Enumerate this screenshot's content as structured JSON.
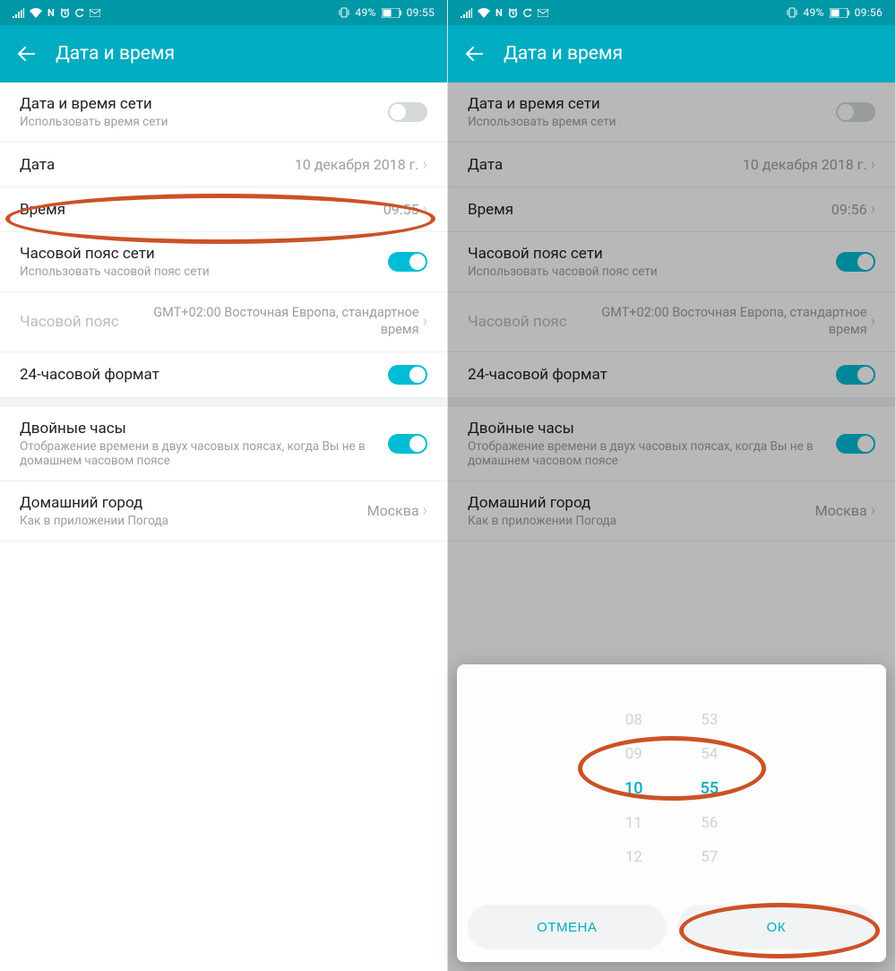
{
  "left": {
    "status": {
      "battery": "49%",
      "time": "09:55"
    },
    "header": {
      "title": "Дата и время"
    },
    "rows": {
      "network_time": {
        "title": "Дата и время сети",
        "sub": "Использовать время сети"
      },
      "date": {
        "title": "Дата",
        "value": "10 декабря 2018 г."
      },
      "time": {
        "title": "Время",
        "value": "09:55"
      },
      "tz_net": {
        "title": "Часовой пояс сети",
        "sub": "Использовать часовой пояс сети"
      },
      "tz": {
        "title": "Часовой пояс",
        "value": "GMT+02:00 Восточная Европа, стандартное время"
      },
      "h24": {
        "title": "24-часовой формат"
      },
      "dual": {
        "title": "Двойные часы",
        "sub": "Отображение времени в двух часовых поясах, когда Вы не в домашнем часовом поясе"
      },
      "home": {
        "title": "Домашний город",
        "sub": "Как в приложении Погода",
        "value": "Москва"
      }
    }
  },
  "right": {
    "status": {
      "battery": "49%",
      "time": "09:56"
    },
    "header": {
      "title": "Дата и время"
    },
    "rows": {
      "network_time": {
        "title": "Дата и время сети",
        "sub": "Использовать время сети"
      },
      "date": {
        "title": "Дата",
        "value": "10 декабря 2018 г."
      },
      "time": {
        "title": "Время",
        "value": "09:56"
      },
      "tz_net": {
        "title": "Часовой пояс сети",
        "sub": "Использовать часовой пояс сети"
      },
      "tz": {
        "title": "Часовой пояс",
        "value": "GMT+02:00 Восточная Европа, стандартное время"
      },
      "h24": {
        "title": "24-часовой формат"
      },
      "dual": {
        "title": "Двойные часы",
        "sub": "Отображение времени в двух часовых поясах, когда Вы не в домашнем часовом поясе"
      },
      "home": {
        "title": "Домашний город",
        "sub": "Как в приложении Погода",
        "value": "Москва"
      }
    },
    "picker": {
      "hours": [
        "08",
        "09",
        "10",
        "11",
        "12"
      ],
      "minutes": [
        "53",
        "54",
        "55",
        "56",
        "57"
      ],
      "selected_hour": "10",
      "selected_minute": "55",
      "cancel": "ОТМЕНА",
      "ok": "ОК"
    }
  }
}
